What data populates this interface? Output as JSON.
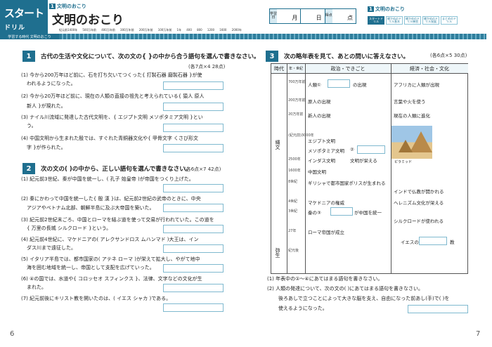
{
  "header": {
    "start": "スタート",
    "drill": "ドリル",
    "unit_num": "1",
    "unit_small": "文明のおこり",
    "title": "文明のおこり"
  },
  "score": {
    "label": "学習日",
    "month": "月",
    "day": "日",
    "score_label": "得点",
    "points": "点"
  },
  "right": {
    "unit_num": "1",
    "unit_title": "文明のおこり",
    "tags": [
      "スタートドリル",
      "確かめのドリル基本",
      "確かめのドリル練習",
      "確かめのドリル発展",
      "まとめのドリル"
    ]
  },
  "timeline": {
    "label": "学習する時代 文明のおこり",
    "ticks": [
      "紀元前1400年",
      "500万年前",
      "400万年前",
      "300万年前",
      "200万年前",
      "100万年前",
      "1年",
      "400",
      "800",
      "1200",
      "1600",
      "2000年"
    ]
  },
  "sec1": {
    "num": "1",
    "head": "古代の生活や文化について、次の文の{ }の中から合う語句を選んで書きなさい。",
    "pts": "(各7点×4 28点)",
    "q": [
      "(1) 今から200万年ほど前に、石を打ち欠いてつくった{ 打製石器 磨製石器 }が使",
      "われるようになった。",
      "(2) 今から20万年ほど前に、現在の人類の直接の祖先と考えられている{ 猿人 原人",
      "新人 }が現れた。",
      "(3) ナイル川流域に発達した古代文明を、{ エジプト文明 メソポタミア文明 }とい",
      "う。",
      "(4) 中国文明から生まれた殷では、すぐれた青銅器文化や{ 甲骨文字 くさび形文",
      "字 }が作られた。"
    ]
  },
  "sec2": {
    "num": "2",
    "head": "次の文の( )の中から、正しい語句を選んで書きなさい。",
    "pts": "(各6点×7 42点)",
    "q": [
      "(1) 紀元前3世紀、秦が中国を統一し、( 孔子 始皇帝 )が帝国をつくり上げた。",
      "(2) 秦にかわって中国を統一した{ 殷 漢 }は、紀元前2世紀の武帝のときに、中央",
      "アジアやベトナム北部、朝鮮半島に及ぶ大帝国を築いた。",
      "(3) 紀元前2世紀末ごろ、中国とローマを結ぶ道を使って交易が行われていた。この道を",
      "{ 万里の長城 シルクロード }という。",
      "(4) 紀元前4世紀に、マケドニアの( アレクサンドロス ムハンマド )大王は、イン",
      "ダス川まで遠征した。",
      "(5) イタリア半島では、都市国家の( アテネ ローマ )が栄えて拡大し、やがて地中",
      "海を囲む地域を統一し、帝国として支配を広げていった。",
      "(6) ④の国では、水道や{ コロッセオ スフィンクス }、法律、文字などの文化が生",
      "まれた。",
      "(7) 紀元前後にキリスト教を開いたのは、( イエス シャカ )である。"
    ]
  },
  "sec3": {
    "num": "3",
    "head": "次の略年表を見て、あとの問いに答えなさい。",
    "pts": "(各6点×5 30点)",
    "table": {
      "h": [
        "時代",
        "年・世紀",
        "政治・できごと",
        "経済・社会・文化"
      ],
      "era1": "縄文",
      "era2": "弥生",
      "years": [
        "700万年前",
        "200万年前",
        "20万年前",
        "(紀元前)3000年",
        "2500年",
        "1600年",
        "8世紀",
        "4世紀",
        "3世紀",
        "27年",
        "紀元後"
      ],
      "pol": [
        "人類①",
        "の出現",
        "原人の出現",
        "新人の出現",
        "エジプト文明",
        "メソポタミア文明",
        "インダス文明",
        "中国文明",
        "②",
        "文明が栄える",
        "ギリシャで都市国家ポリスが生まれる",
        "マケドニアの権威",
        "秦の③",
        "が中国を統一",
        "ローマ帝国が成立"
      ],
      "cult": [
        "アフリカに人類が出現",
        "言葉や火を使う",
        "現在の人類に進化",
        "ピラミッド",
        "インドで仏教が開かれる",
        "ヘレニズム文化が栄える",
        "シルクロードが使われる",
        "イエスの④",
        "教"
      ]
    },
    "q": [
      "(1) 年表中の①〜④にあてはまる語句を書きなさい。",
      "(2) 人類の発達について、次の文の( )にあてはまる語句を書きなさい。",
      "後ろあしで立つことによって大きな脳を支え、自由になった前あし(手)で( )を",
      "使えるようになった。"
    ]
  },
  "pages": [
    "6",
    "7"
  ]
}
